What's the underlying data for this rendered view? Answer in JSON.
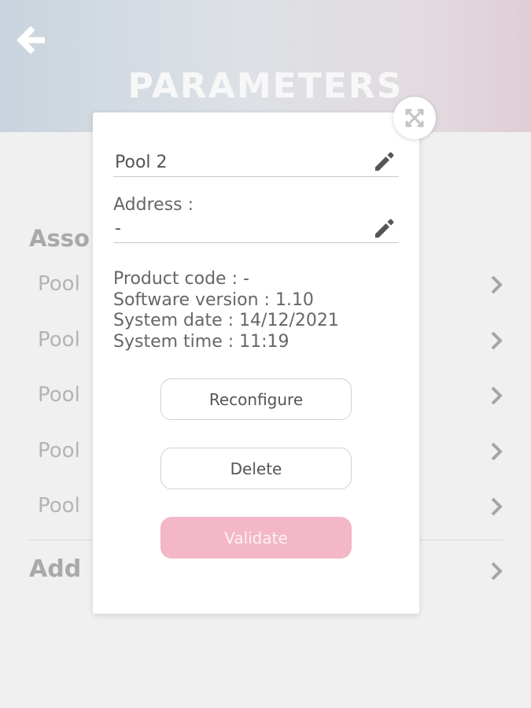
{
  "header": {
    "title": "PARAMETERS"
  },
  "background": {
    "section_title": "Asso",
    "items": [
      {
        "label": "Pool"
      },
      {
        "label": "Pool"
      },
      {
        "label": "Pool"
      },
      {
        "label": "Pool"
      },
      {
        "label": "Pool"
      }
    ],
    "add_label": "Add"
  },
  "dialog": {
    "name_value": "Pool 2",
    "address_caption": "Address :",
    "address_value": "-",
    "info": {
      "product_code": "Product code : -",
      "software_version": "Software version : 1.10",
      "system_date": "System date : 14/12/2021",
      "system_time": "System time : 11:19"
    },
    "buttons": {
      "reconfigure": "Reconfigure",
      "delete": "Delete",
      "validate": "Validate"
    }
  },
  "icons": {
    "back": "arrow-left-icon",
    "close": "close-icon",
    "edit": "pencil-icon",
    "chevron": "chevron-right-icon"
  },
  "colors": {
    "validate_bg": "#f3b7c8",
    "background": "#f0f0f1"
  }
}
